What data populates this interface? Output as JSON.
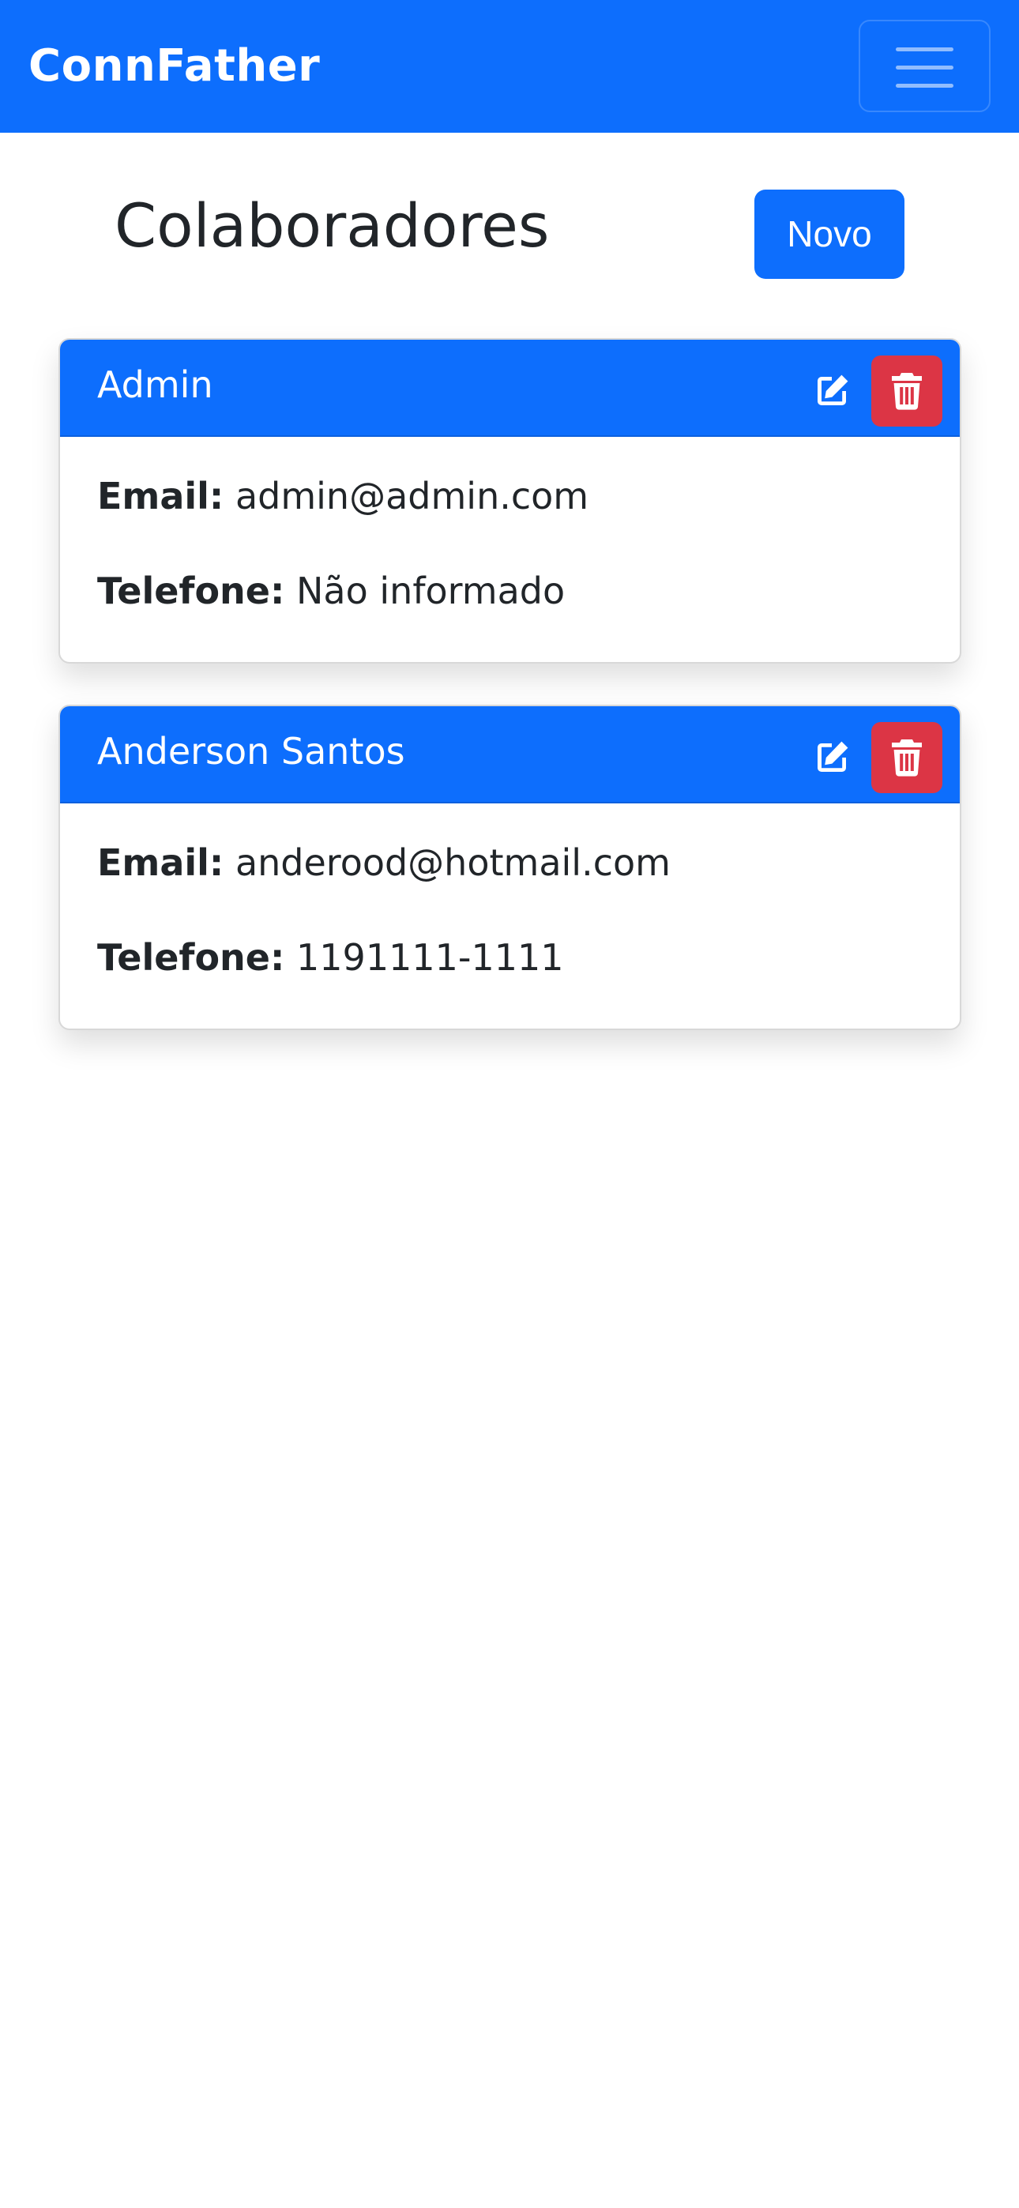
{
  "navbar": {
    "brand": "ConnFather",
    "toggler_icon": "hamburger-menu-icon",
    "background": "#0d6efd"
  },
  "page": {
    "title": "Colaboradores",
    "new_button_label": "Novo"
  },
  "cards": [
    {
      "name": "Admin",
      "email_label": "Email:",
      "email": "admin@admin.com",
      "phone_label": "Telefone:",
      "phone": "Não informado",
      "edit_icon": "edit-icon",
      "delete_icon": "trash-icon"
    },
    {
      "name": "Anderson Santos",
      "email_label": "Email:",
      "email": "anderood@hotmail.com",
      "phone_label": "Telefone:",
      "phone": "1191111-1111",
      "edit_icon": "edit-icon",
      "delete_icon": "trash-icon"
    }
  ],
  "colors": {
    "primary": "#0d6efd",
    "danger": "#dc3545",
    "text": "#212529"
  }
}
